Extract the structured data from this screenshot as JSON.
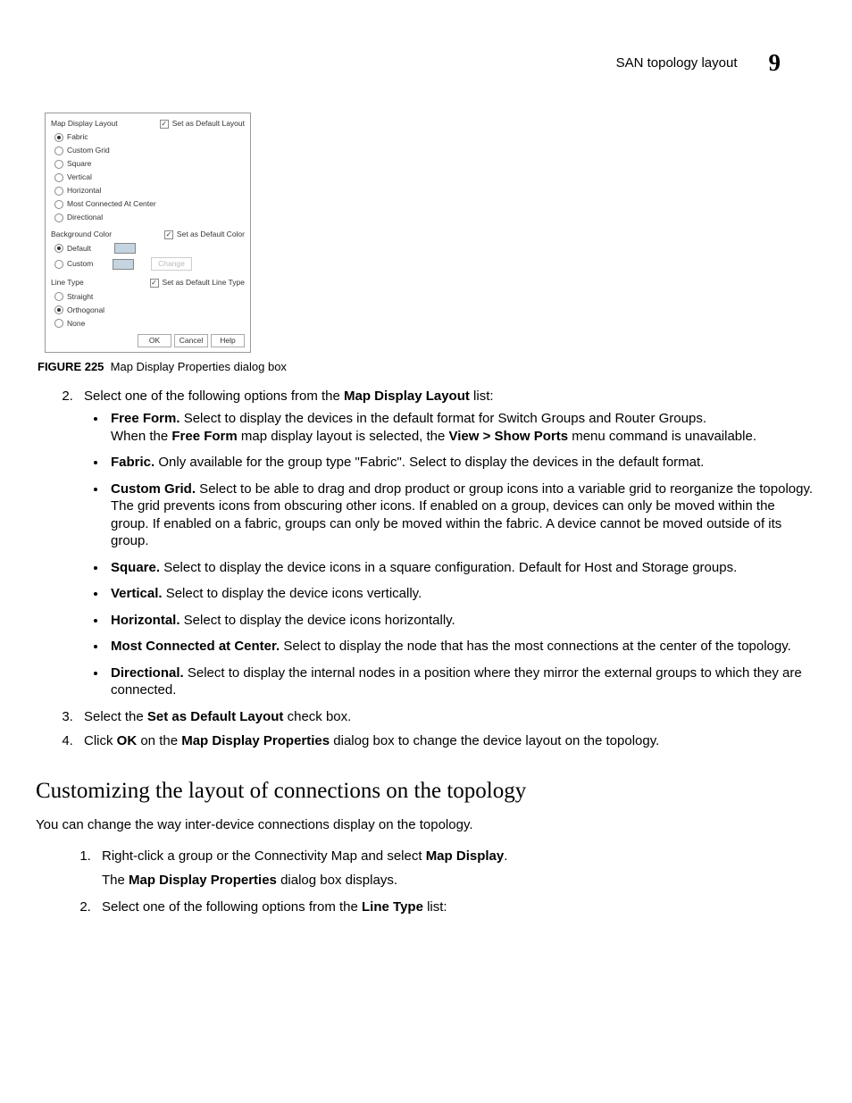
{
  "header": {
    "title": "SAN topology layout",
    "chapter": "9"
  },
  "figure": {
    "label": "FIGURE 225",
    "caption": "Map Display Properties dialog box",
    "dialog": {
      "mapDisplayLayout": {
        "title": "Map Display Layout",
        "setDefault": "Set as Default Layout",
        "options": [
          "Fabric",
          "Custom Grid",
          "Square",
          "Vertical",
          "Horizontal",
          "Most Connected At Center",
          "Directional"
        ],
        "selected": "Fabric"
      },
      "backgroundColor": {
        "title": "Background Color",
        "setDefault": "Set as Default Color",
        "options": [
          "Default",
          "Custom"
        ],
        "selected": "Default",
        "changeBtn": "Change"
      },
      "lineType": {
        "title": "Line Type",
        "setDefault": "Set as Default Line Type",
        "options": [
          "Straight",
          "Orthogonal",
          "None"
        ],
        "selected": "Orthogonal"
      },
      "buttons": {
        "ok": "OK",
        "cancel": "Cancel",
        "help": "Help"
      }
    }
  },
  "step2": {
    "intro_pre": "Select one of the following options from the ",
    "intro_b": "Map Display Layout",
    "intro_post": " list:",
    "items": [
      {
        "b": "Free Form.",
        "t": " Select to display the devices in the default format for Switch Groups and Router Groups.",
        "extra_pre": "When the ",
        "extra_b1": "Free Form",
        "extra_mid": " map display layout is selected, the ",
        "extra_b2": "View > Show Ports",
        "extra_post": " menu command is unavailable."
      },
      {
        "b": "Fabric.",
        "t": " Only available for the group type \"Fabric\". Select to display the devices in the default format."
      },
      {
        "b": "Custom Grid.",
        "t": " Select to be able to drag and drop product or group icons into a variable grid to reorganize the topology. The grid prevents icons from obscuring other icons. If enabled on a group, devices can only be moved within the group. If enabled on a fabric, groups can only be moved within the fabric. A device cannot be moved outside of its group."
      },
      {
        "b": "Square.",
        "t": " Select to display the device icons in a square configuration. Default for Host and Storage groups."
      },
      {
        "b": "Vertical.",
        "t": " Select to display the device icons vertically."
      },
      {
        "b": "Horizontal.",
        "t": " Select to display the device icons horizontally."
      },
      {
        "b": "Most Connected at Center.",
        "t": " Select to display the node that has the most connections at the center of the topology."
      },
      {
        "b": "Directional.",
        "t": " Select to display the internal nodes in a position where they mirror the external groups to which they are connected."
      }
    ]
  },
  "step3": {
    "pre": "Select the ",
    "b": "Set as Default Layout",
    "post": " check box."
  },
  "step4": {
    "pre": "Click ",
    "b1": "OK",
    "mid": " on the ",
    "b2": "Map Display Properties",
    "post": " dialog box to change the device layout on the topology."
  },
  "section2": {
    "title": "Customizing the layout of connections on the topology",
    "intro": "You can change the way inter-device connections display on the topology.",
    "s1": {
      "pre": "Right-click a group or the Connectivity Map and select ",
      "b": "Map Display",
      "post": ".",
      "note_pre": "The ",
      "note_b": "Map Display Properties",
      "note_post": " dialog box displays."
    },
    "s2": {
      "pre": "Select one of the following options from the ",
      "b": "Line Type",
      "post": " list:"
    }
  }
}
